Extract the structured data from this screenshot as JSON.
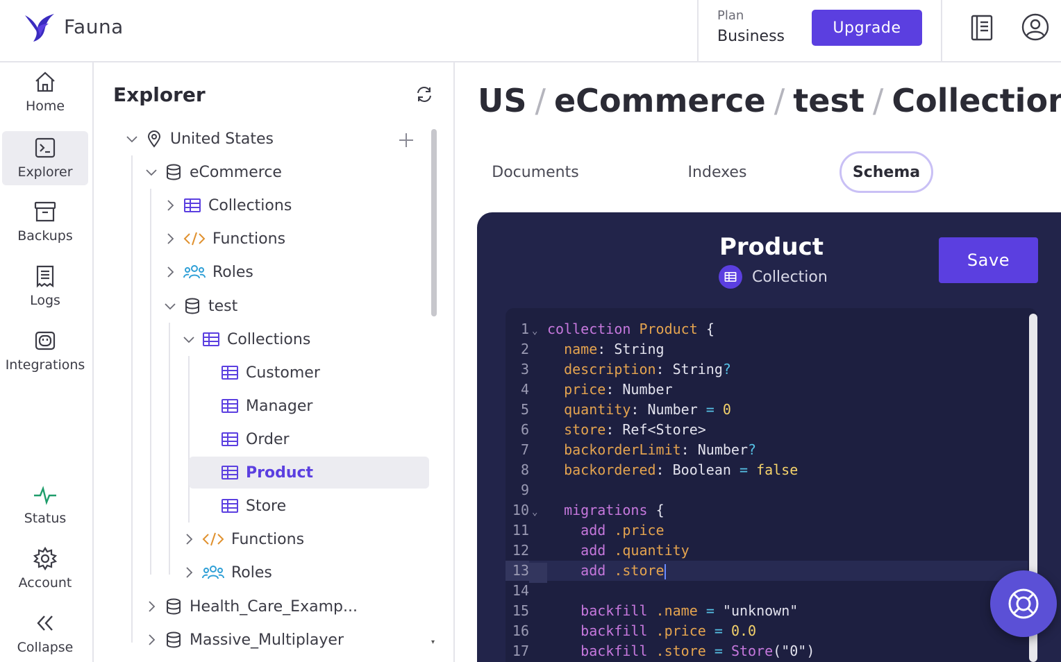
{
  "header": {
    "brand": "Fauna",
    "plan_label": "Plan",
    "plan_value": "Business",
    "upgrade_label": "Upgrade"
  },
  "nav": {
    "home": "Home",
    "explorer": "Explorer",
    "backups": "Backups",
    "logs": "Logs",
    "integrations": "Integrations",
    "status": "Status",
    "account": "Account",
    "collapse": "Collapse"
  },
  "explorer": {
    "title": "Explorer",
    "tree": {
      "region": "United States",
      "db1": "eCommerce",
      "db1_collections": "Collections",
      "db1_functions": "Functions",
      "db1_roles": "Roles",
      "db2": "test",
      "db2_collections": "Collections",
      "coll_customer": "Customer",
      "coll_manager": "Manager",
      "coll_order": "Order",
      "coll_product": "Product",
      "coll_store": "Store",
      "db2_functions": "Functions",
      "db2_roles": "Roles",
      "db3": "Health_Care_Examp...",
      "db4": "Massive_Multiplayer"
    }
  },
  "breadcrumb": {
    "part1": "US",
    "part2": "eCommerce",
    "part3": "test",
    "part4": "Collections",
    "part5": "...",
    "sep": "/"
  },
  "tabs": {
    "documents": "Documents",
    "indexes": "Indexes",
    "schema": "Schema"
  },
  "editor": {
    "title": "Product",
    "subtitle": "Collection",
    "save_label": "Save",
    "active_line": 13
  },
  "colors": {
    "accent": "#5b3fe0",
    "editor_bg": "#22244a",
    "code_bg": "#1d1f40"
  }
}
